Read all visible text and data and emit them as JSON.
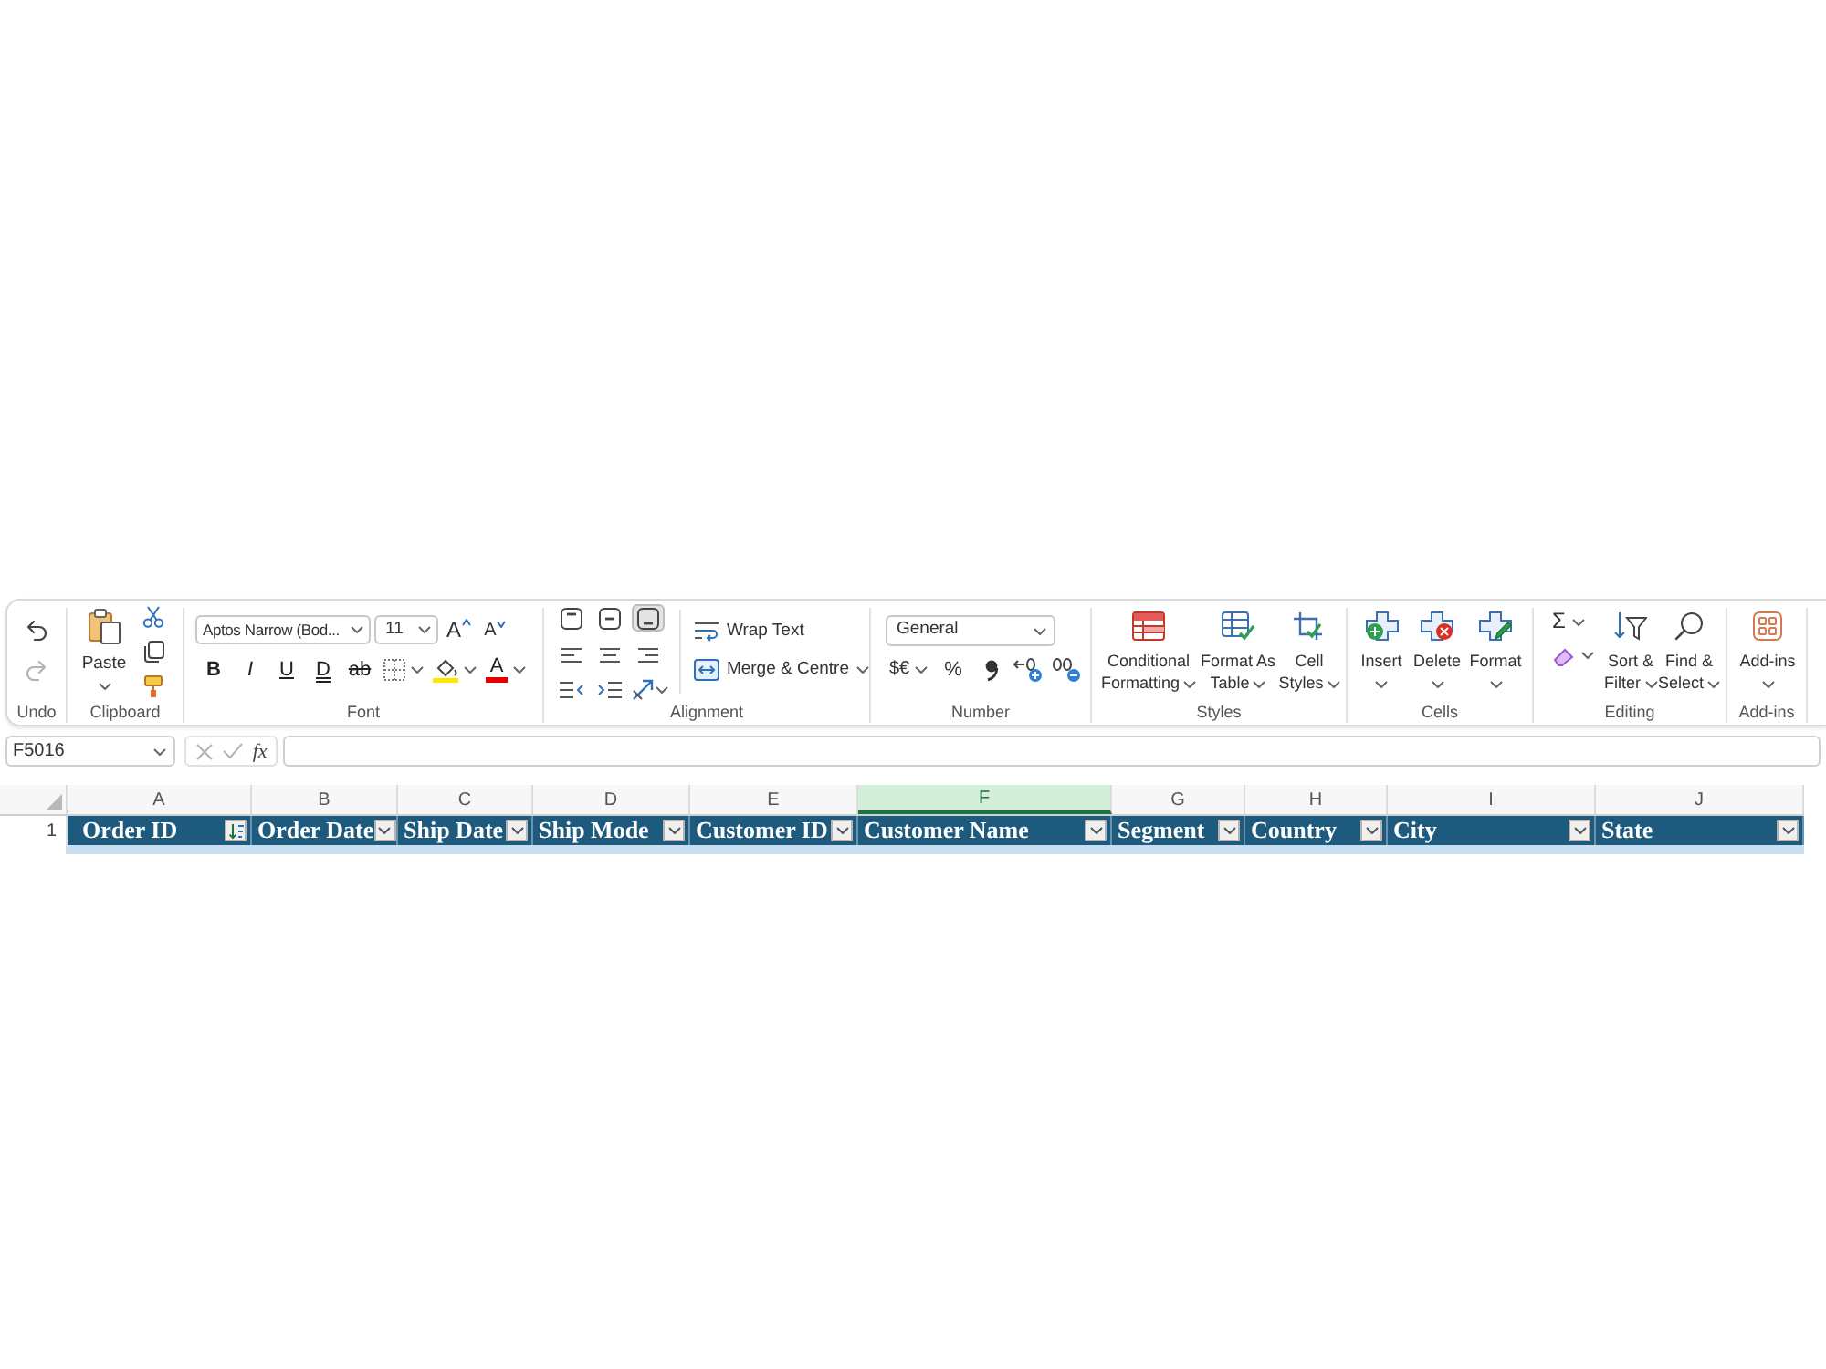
{
  "ribbon": {
    "undo": {
      "label": "Undo",
      "undo_button": {
        "disabled": false
      },
      "redo_button": {
        "disabled": true
      }
    },
    "clipboard": {
      "label": "Clipboard",
      "paste": "Paste"
    },
    "font": {
      "label": "Font",
      "font_name": "Aptos Narrow (Bod...",
      "font_size": "11",
      "grow_font": "A",
      "shrink_font": "A",
      "styles": [
        {
          "kind": "bold",
          "text": "B"
        },
        {
          "kind": "italic",
          "text": "I"
        },
        {
          "kind": "underline",
          "text": "U"
        },
        {
          "kind": "double_underline",
          "text": "D"
        },
        {
          "kind": "strikethrough",
          "text": "ab"
        }
      ],
      "font_color": "A"
    },
    "alignment": {
      "label": "Alignment",
      "vertical": [
        {
          "selected": false
        },
        {
          "selected": false
        },
        {
          "selected": true
        }
      ],
      "horizontal": [
        {
          "selected": false
        },
        {
          "selected": false
        },
        {
          "selected": false
        }
      ],
      "wrap_text": "Wrap Text",
      "merge": "Merge & Centre"
    },
    "number": {
      "label": "Number",
      "format": "General",
      "currency": "$€",
      "percent": "%"
    },
    "styles": {
      "label": "Styles",
      "buttons": [
        "Conditional Formatting",
        "Format As Table",
        "Cell Styles"
      ]
    },
    "cells": {
      "label": "Cells",
      "buttons": [
        "Insert",
        "Delete",
        "Format"
      ]
    },
    "editing": {
      "label": "Editing",
      "autosum": "Σ",
      "buttons": [
        "Sort & Filter",
        "Find & Select"
      ]
    },
    "add_ins": {
      "label": "Add-ins",
      "button": "Add-ins"
    }
  },
  "formula_bar": {
    "name_box": "F5016",
    "cancel": {
      "disabled": true
    },
    "enter": {
      "disabled": true
    },
    "function_button": "fx"
  },
  "sheet": {
    "row_number": "1",
    "columns": [
      {
        "letter": "A",
        "selected": false,
        "title": "Order ID",
        "sorted": true
      },
      {
        "letter": "B",
        "selected": false,
        "title": "Order Date",
        "sorted": false
      },
      {
        "letter": "C",
        "selected": false,
        "title": "Ship Date",
        "sorted": false
      },
      {
        "letter": "D",
        "selected": false,
        "title": "Ship Mode",
        "sorted": false
      },
      {
        "letter": "E",
        "selected": false,
        "title": "Customer ID",
        "sorted": false
      },
      {
        "letter": "F",
        "selected": true,
        "title": "Customer Name",
        "sorted": false
      },
      {
        "letter": "G",
        "selected": false,
        "title": "Segment",
        "sorted": false
      },
      {
        "letter": "H",
        "selected": false,
        "title": "Country",
        "sorted": false
      },
      {
        "letter": "I",
        "selected": false,
        "title": "City",
        "sorted": false
      },
      {
        "letter": "J",
        "selected": false,
        "title": "State",
        "sorted": false
      }
    ]
  }
}
